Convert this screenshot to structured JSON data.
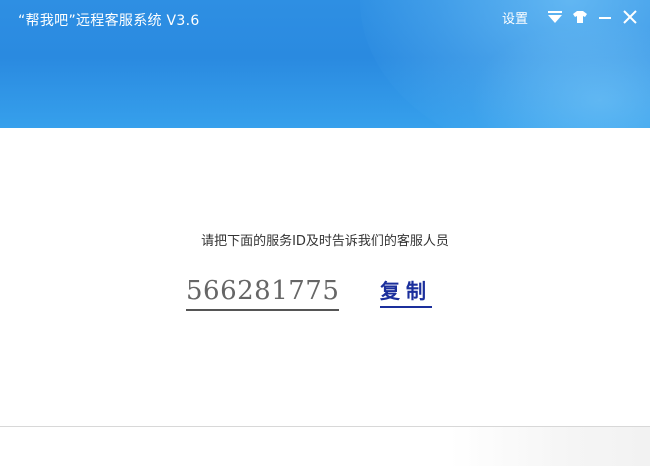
{
  "window": {
    "title": "“帮我吧”远程客服系统  V3.6"
  },
  "controls": {
    "settings_label": "设置",
    "dropdown_icon": "triangle-down-icon",
    "skin_icon": "shirt-icon",
    "minimize_icon": "minimize-icon",
    "close_icon": "close-icon"
  },
  "main": {
    "instruction": "请把下面的服务ID及时告诉我们的客服人员",
    "service_id": "566281775",
    "copy_label": "复制"
  },
  "colors": {
    "header_blue": "#2e8fe3",
    "link_blue": "#1b2f9c",
    "text_gray": "#666666"
  }
}
